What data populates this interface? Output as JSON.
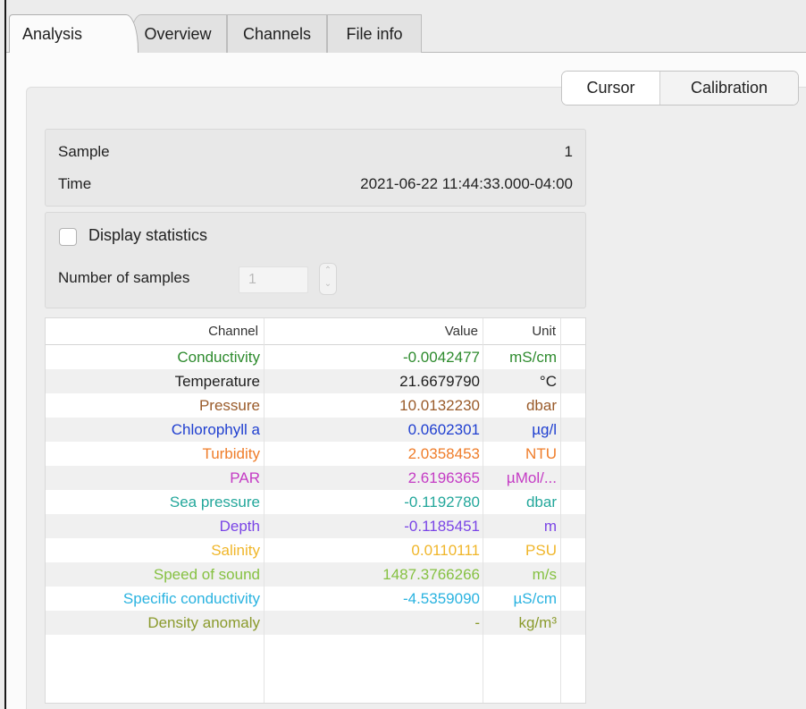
{
  "tabs": {
    "analysis": "Analysis",
    "overview": "Overview",
    "channels": "Channels",
    "file_info": "File info"
  },
  "segmented": {
    "cursor": "Cursor",
    "calibration": "Calibration"
  },
  "sample_info": {
    "sample_label": "Sample",
    "sample_value": "1",
    "time_label": "Time",
    "time_value": "2021-06-22 11:44:33.000-04:00"
  },
  "statistics": {
    "display_label": "Display statistics",
    "checked": false,
    "num_samples_label": "Number of samples",
    "num_samples_value": "1"
  },
  "table": {
    "headers": {
      "channel": "Channel",
      "value": "Value",
      "unit": "Unit"
    },
    "rows": [
      {
        "channel": "Conductivity",
        "value": "-0.0042477",
        "unit": "mS/cm",
        "color": "#2e8b2e"
      },
      {
        "channel": "Temperature",
        "value": "21.6679790",
        "unit": "°C",
        "color": "#1e1e1e"
      },
      {
        "channel": "Pressure",
        "value": "10.0132230",
        "unit": "dbar",
        "color": "#9a5b2a"
      },
      {
        "channel": "Chlorophyll a",
        "value": "0.0602301",
        "unit": "µg/l",
        "color": "#1f3fd0"
      },
      {
        "channel": "Turbidity",
        "value": "2.0358453",
        "unit": "NTU",
        "color": "#ef7d2a"
      },
      {
        "channel": "PAR",
        "value": "2.6196365",
        "unit": "µMol/...",
        "color": "#c43bc4"
      },
      {
        "channel": "Sea pressure",
        "value": "-0.1192780",
        "unit": "dbar",
        "color": "#23a79b"
      },
      {
        "channel": "Depth",
        "value": "-0.1185451",
        "unit": "m",
        "color": "#7a45e6"
      },
      {
        "channel": "Salinity",
        "value": "0.0110111",
        "unit": "PSU",
        "color": "#f0b62a"
      },
      {
        "channel": "Speed of sound",
        "value": "1487.3766266",
        "unit": "m/s",
        "color": "#86c142"
      },
      {
        "channel": "Specific conductivity",
        "value": "-4.5359090",
        "unit": "µS/cm",
        "color": "#2ab3e0"
      },
      {
        "channel": "Density anomaly",
        "value": "-",
        "unit": "kg/m³",
        "color": "#8a9a2c"
      }
    ]
  }
}
